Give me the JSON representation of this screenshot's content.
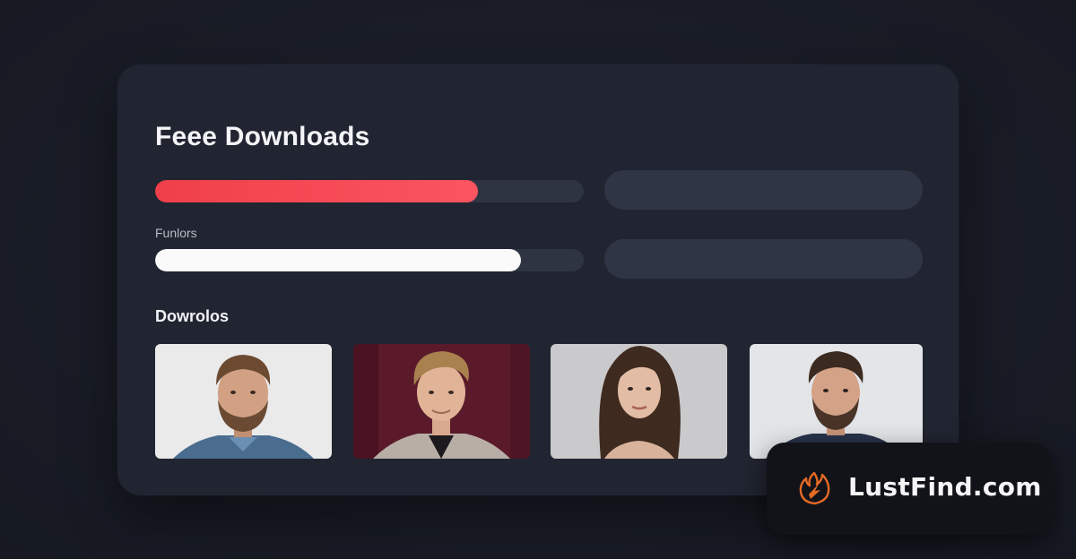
{
  "card": {
    "title": "Feee Downloads",
    "progress_primary": {
      "percent": 75.3,
      "color": "#f24750"
    },
    "secondary_label": "Funlors",
    "progress_secondary": {
      "percent": 85.4,
      "color": "#fafafa"
    },
    "section_title": "Dowrolos"
  },
  "thumbnails": [
    {
      "icon": "portrait-man-bearded-denim-shirt",
      "background": "#e9e9ea"
    },
    {
      "icon": "portrait-man-blond-on-burgundy",
      "background": "#5b1a2a"
    },
    {
      "icon": "portrait-woman-long-brown-hair",
      "background": "#c9c9cb"
    },
    {
      "icon": "portrait-man-bearded-navy-shirt",
      "background": "#e3e5e8"
    }
  ],
  "brand_badge": {
    "text": "LustFind.com",
    "icon": "flame-logo-icon",
    "accent": "#e56a24"
  }
}
